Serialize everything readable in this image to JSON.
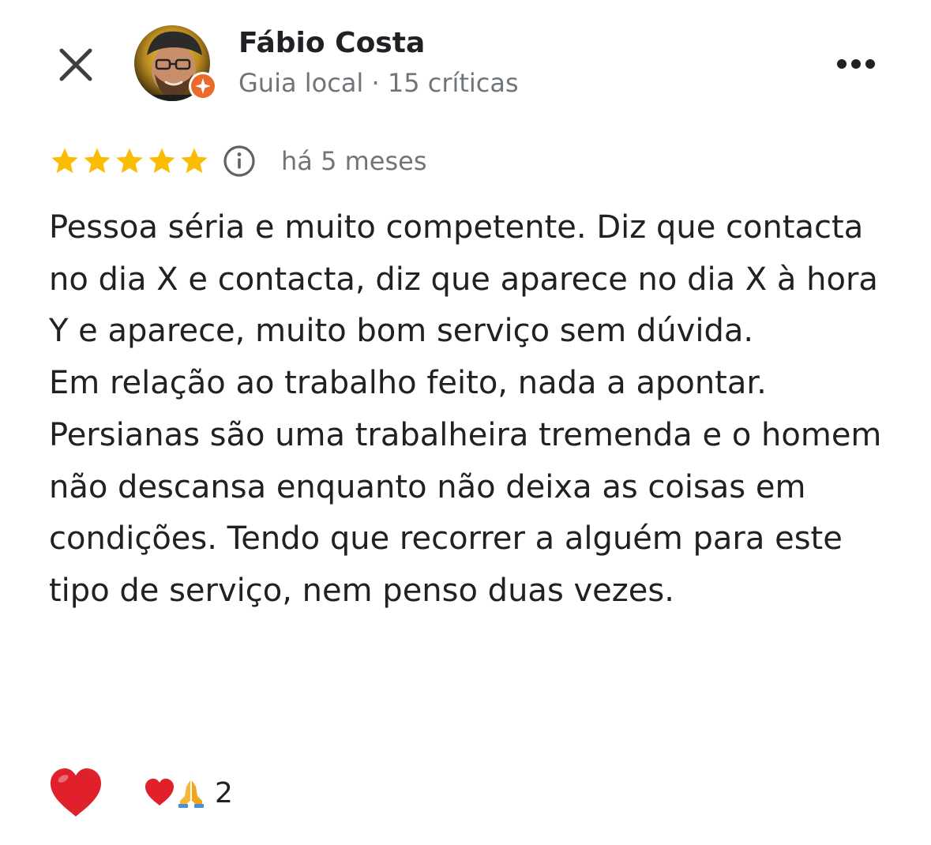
{
  "header": {
    "close_icon": "close-icon",
    "reviewer_name": "Fábio Costa",
    "reviewer_subtitle": "Guia local · 15 críticas",
    "avatar_badge_icon": "local-guide-star-icon",
    "more_icon": "more-horizontal-icon"
  },
  "rating": {
    "stars": 5,
    "max_stars": 5,
    "star_color": "#FBBC04",
    "info_icon": "info-icon",
    "time_ago": "há 5 meses"
  },
  "review": {
    "paragraphs": [
      "Pessoa séria e muito competente. Diz que contacta no dia X e contacta, diz que aparece no dia X à hora Y e aparece, muito bom serviço sem dúvida.",
      "Em relação ao trabalho feito, nada a apontar. Persianas são uma trabalheira tremenda e o homem não descansa enquanto não deixa as coisas em condições. Tendo que recorrer a alguém para este tipo de serviço, nem penso duas vezes."
    ]
  },
  "reactions": {
    "react_icon": "heart-icon",
    "summary_icons": [
      "heart-icon",
      "folded-hands-icon"
    ],
    "count": "2",
    "heart_color": "#E0202A",
    "badge_color": "#EA6A2C"
  }
}
